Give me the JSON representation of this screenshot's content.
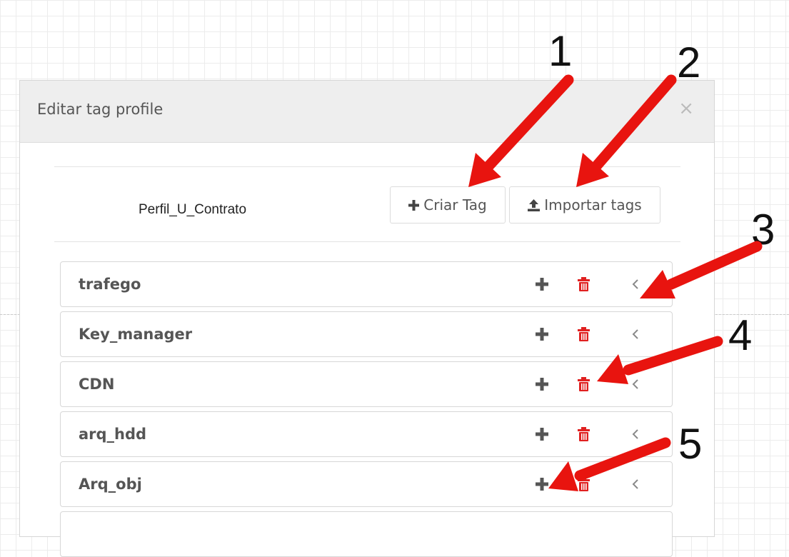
{
  "modal": {
    "title": "Editar tag profile",
    "close_symbol": "×"
  },
  "profile_name": "Perfil_U_Contrato",
  "buttons": {
    "create_tag": "Criar Tag",
    "import_tags": "Importar tags"
  },
  "tags": [
    {
      "label": "trafego"
    },
    {
      "label": "Key_manager"
    },
    {
      "label": "CDN"
    },
    {
      "label": "arq_hdd"
    },
    {
      "label": "Arq_obj"
    }
  ],
  "annotations": [
    "1",
    "2",
    "3",
    "4",
    "5"
  ],
  "colors": {
    "arrow_red": "#e8140f",
    "trash_red": "#e02020",
    "header_bg": "#eeeeee"
  },
  "icons": [
    "plus-icon",
    "upload-icon",
    "trash-icon",
    "chevron-left-icon",
    "close-icon"
  ]
}
